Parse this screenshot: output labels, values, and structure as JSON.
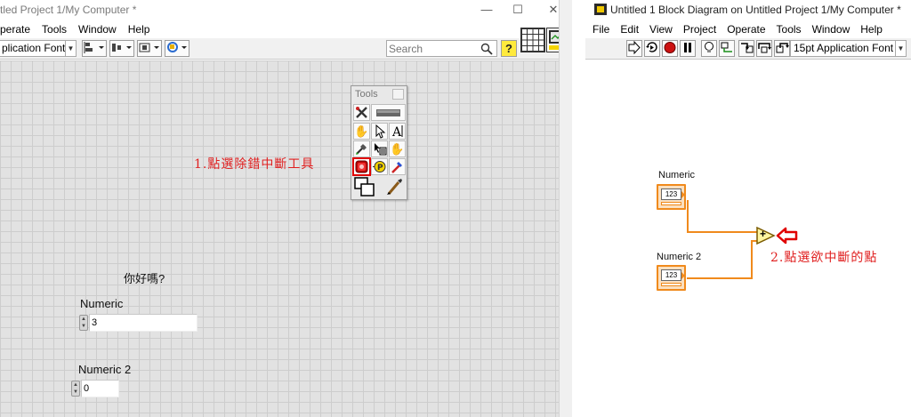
{
  "front_panel": {
    "title": "tled Project 1/My Computer *",
    "window_buttons": [
      "—",
      "☐",
      "✕"
    ],
    "menu": [
      "perate",
      "Tools",
      "Window",
      "Help"
    ],
    "font_select": "plication Font",
    "search_placeholder": "Search",
    "help_button": "?",
    "tools_palette": {
      "title": "Tools"
    },
    "annotation": "1.點選除錯中斷工具",
    "greeting": "你好嗎?",
    "numeric1": {
      "label": "Numeric",
      "value": "3"
    },
    "numeric2": {
      "label": "Numeric 2",
      "value": "0"
    }
  },
  "block_diagram": {
    "title": "Untitled 1 Block Diagram on Untitled Project 1/My Computer *",
    "menu": [
      "File",
      "Edit",
      "View",
      "Project",
      "Operate",
      "Tools",
      "Window",
      "Help"
    ],
    "font_select": "15pt Application Font",
    "numeric1": {
      "label": "Numeric",
      "type": "I32",
      "glyph": "123"
    },
    "numeric2": {
      "label": "Numeric 2",
      "type": "I32",
      "glyph": "123"
    },
    "add_symbol": "+",
    "annotation": "2.點選欲中斷的點"
  },
  "colors": {
    "wire": "#f08a1c",
    "annotation": "#e02020",
    "selection": "#e00000"
  }
}
